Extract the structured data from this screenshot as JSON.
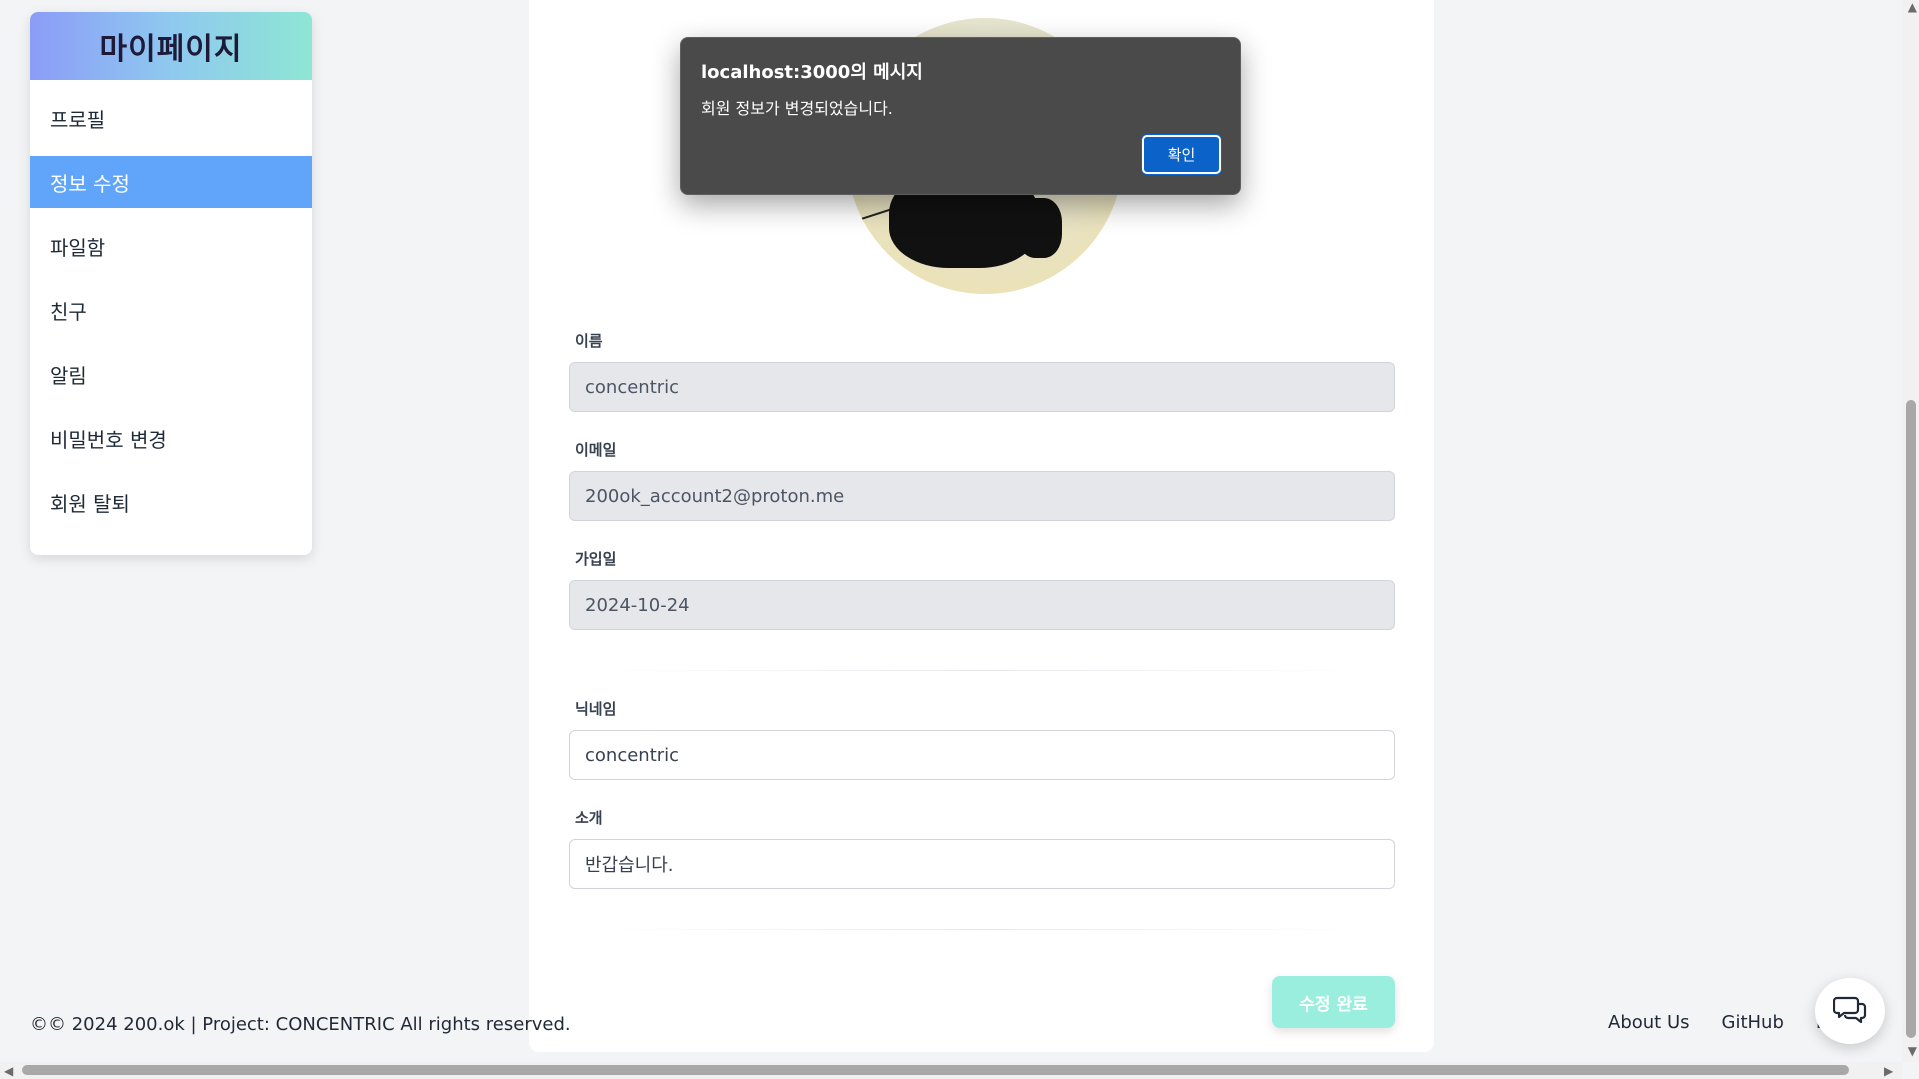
{
  "sidebar": {
    "title": "마이페이지",
    "items": [
      {
        "label": "프로필",
        "active": false
      },
      {
        "label": "정보 수정",
        "active": true
      },
      {
        "label": "파일함",
        "active": false
      },
      {
        "label": "친구",
        "active": false
      },
      {
        "label": "알림",
        "active": false
      },
      {
        "label": "비밀번호 변경",
        "active": false
      },
      {
        "label": "회원 탈퇴",
        "active": false
      }
    ]
  },
  "form": {
    "name_label": "이름",
    "name_value": "concentric",
    "email_label": "이메일",
    "email_value": "200ok_account2@proton.me",
    "joined_label": "가입일",
    "joined_value": "2024-10-24",
    "nickname_label": "닉네임",
    "nickname_value": "concentric",
    "intro_label": "소개",
    "intro_value": "반갑습니다.",
    "submit_label": "수정 완료"
  },
  "footer": {
    "copyright": "©© 2024 200.ok | Project: CONCENTRIC All rights reserved.",
    "links": [
      "About Us",
      "GitHub",
      "L"
    ]
  },
  "alert": {
    "title": "localhost:3000의 메시지",
    "message": "회원 정보가 변경되었습니다.",
    "ok_label": "확인"
  },
  "colors": {
    "sidebar_active": "#60a5fa",
    "submit_button": "#99eedd",
    "alert_ok": "#0b63c9"
  },
  "icons": {
    "chat": "chat-bubbles-icon"
  }
}
